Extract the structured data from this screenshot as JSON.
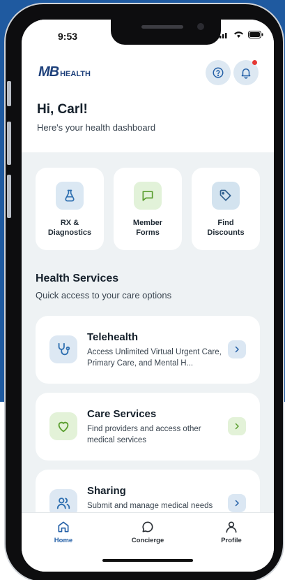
{
  "status_bar": {
    "time": "9:53"
  },
  "header": {
    "logo_mark": "MB",
    "logo_word": "HEALTH",
    "help_icon": "help-circle-icon",
    "bell_icon": "bell-icon"
  },
  "greeting": {
    "title": "Hi, Carl!",
    "subtitle": "Here's your health dashboard"
  },
  "quick_actions": [
    {
      "line1": "RX &",
      "line2": "Diagnostics",
      "icon": "flask-icon",
      "bg": "#dbe8f3",
      "color": "#2e6fb0"
    },
    {
      "line1": "Member",
      "line2": "Forms",
      "icon": "message-square-icon",
      "bg": "#e2f2d9",
      "color": "#5a9e2f"
    },
    {
      "line1": "Find",
      "line2": "Discounts",
      "icon": "tag-icon",
      "bg": "#d3e3ef",
      "color": "#2e5f8f"
    }
  ],
  "services": {
    "title": "Health Services",
    "subtitle": "Quick access to your care options",
    "cards": [
      {
        "title": "Telehealth",
        "desc": "Access Unlimited Virtual Urgent Care, Primary Care, and Mental H...",
        "icon": "stethoscope-icon",
        "bg": "#dde8f3",
        "color": "#2e6fb0",
        "go_bg": "#dbe7f3"
      },
      {
        "title": "Care Services",
        "desc": "Find providers and access other medical services",
        "icon": "heart-icon",
        "bg": "#e3f2d8",
        "color": "#5a9e2f",
        "go_bg": "#e3f2d8"
      },
      {
        "title": "Sharing",
        "desc": "Submit and manage medical needs",
        "icon": "users-icon",
        "bg": "#dde8f3",
        "color": "#2e6fb0",
        "go_bg": "#dbe7f3"
      }
    ]
  },
  "tabbar": {
    "items": [
      {
        "label": "Home",
        "icon": "home-icon",
        "active": true
      },
      {
        "label": "Concierge",
        "icon": "chat-bubble-icon",
        "active": false
      },
      {
        "label": "Profile",
        "icon": "user-icon",
        "active": false
      }
    ]
  },
  "colors": {
    "brand_navy": "#1c3f7a",
    "brand_green": "#6cb33f",
    "active_tab": "#2460a7",
    "background_blue": "#1f5aa0"
  }
}
